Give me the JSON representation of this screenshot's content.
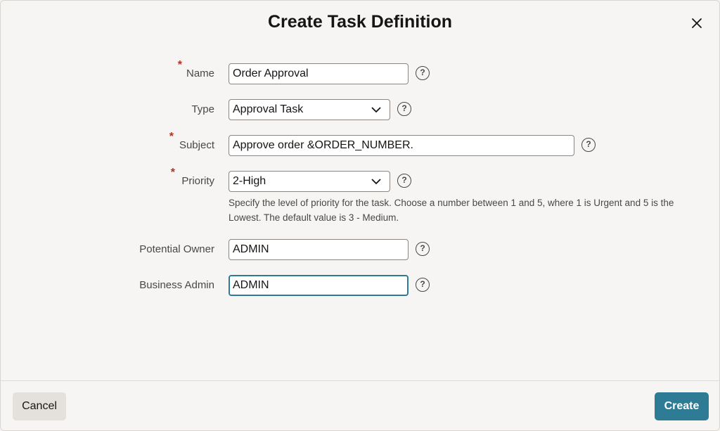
{
  "dialog": {
    "title": "Create Task Definition",
    "close_icon": "close-icon"
  },
  "fields": {
    "name": {
      "label": "Name",
      "required": "*",
      "value": "Order Approval"
    },
    "type": {
      "label": "Type",
      "value": "Approval Task"
    },
    "subject": {
      "label": "Subject",
      "required": "*",
      "value": "Approve order &ORDER_NUMBER."
    },
    "priority": {
      "label": "Priority",
      "required": "*",
      "value": "2-High",
      "hint": "Specify the level of priority for the task. Choose a number between 1 and 5, where 1 is Urgent and 5 is the Lowest. The default value is 3 - Medium."
    },
    "potential_owner": {
      "label": "Potential Owner",
      "value": "ADMIN"
    },
    "business_admin": {
      "label": "Business Admin",
      "value": "ADMIN"
    }
  },
  "help_glyph": "?",
  "footer": {
    "cancel_label": "Cancel",
    "create_label": "Create"
  },
  "colors": {
    "accent": "#2e7b96",
    "required": "#b3311f"
  }
}
